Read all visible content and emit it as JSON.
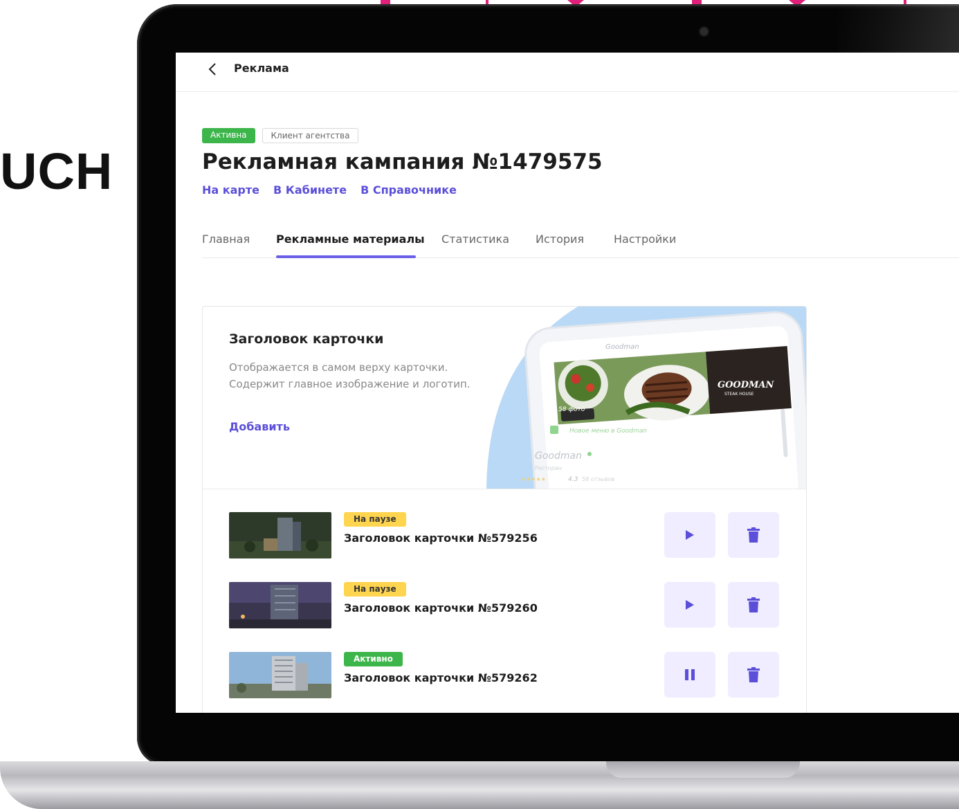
{
  "background_text": "UCH",
  "header": {
    "title": "Реклама"
  },
  "campaign": {
    "badges": [
      "Активна",
      "Клиент агентства"
    ],
    "title": "Рекламная кампания №1479575",
    "links": [
      "На карте",
      "В Кабинете",
      "В Справочнике"
    ]
  },
  "tabs": [
    {
      "label": "Главная",
      "active": false
    },
    {
      "label": "Рекламные материалы",
      "active": true
    },
    {
      "label": "Статистика",
      "active": false
    },
    {
      "label": "История",
      "active": false
    },
    {
      "label": "Настройки",
      "active": false
    }
  ],
  "header_card": {
    "title": "Заголовок карточки",
    "description": "Отображается в самом верху карточки. Содержит главное изображение и логотип.",
    "add_label": "Добавить",
    "preview": {
      "search_text": "Goodman",
      "photo_count": "58 фото",
      "logo_text": "GOODMAN",
      "logo_subtext": "STEAK HOUSE",
      "news_text": "Новое меню в Goodman",
      "place_name": "Goodman",
      "place_type": "Ресторан",
      "rating": "4.3",
      "reviews": "58 отзывов"
    }
  },
  "items": [
    {
      "status": "На паузе",
      "status_type": "pause",
      "title": "Заголовок карточки №579256",
      "action_icon": "play-icon"
    },
    {
      "status": "На паузе",
      "status_type": "pause",
      "title": "Заголовок карточки №579260",
      "action_icon": "play-icon"
    },
    {
      "status": "Активно",
      "status_type": "active",
      "title": "Заголовок карточки №579262",
      "action_icon": "pause-icon"
    }
  ],
  "colors": {
    "accent": "#5b4fd9",
    "active_green": "#3cb54a",
    "pause_yellow": "#ffd54f",
    "button_bg": "#efedff"
  }
}
